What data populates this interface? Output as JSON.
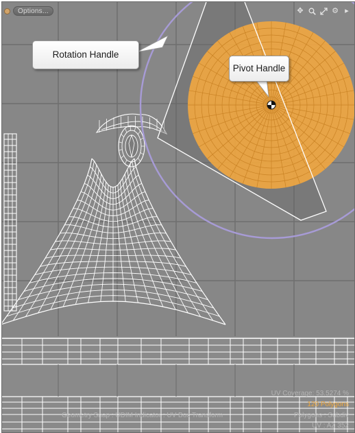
{
  "toolbar": {
    "options_label": "Options...",
    "icons": [
      "move-view-icon",
      "zoom-icon",
      "fit-view-icon",
      "gear-icon",
      "expand-arrow-icon"
    ]
  },
  "callouts": {
    "rotation": "Rotation Handle",
    "pivot": "Pivot Handle"
  },
  "status": {
    "uv_coverage": "UV Coverage: 53.5274 %",
    "polygon_count": "120 Polygons",
    "polygons_mode": "Polygons : Subdiv",
    "view_info": "UV : AZ 352",
    "overlay_info": "Geometry Snap : UDIM Indicator : UV Box Transform"
  },
  "colors": {
    "background": "#878787",
    "grid": "#6f6f6f",
    "uv_wire": "#ffffff",
    "rotation_circle": "#a79bd6",
    "pivot_disc": "#f2a740",
    "polygon_count": "#f0a83c"
  }
}
